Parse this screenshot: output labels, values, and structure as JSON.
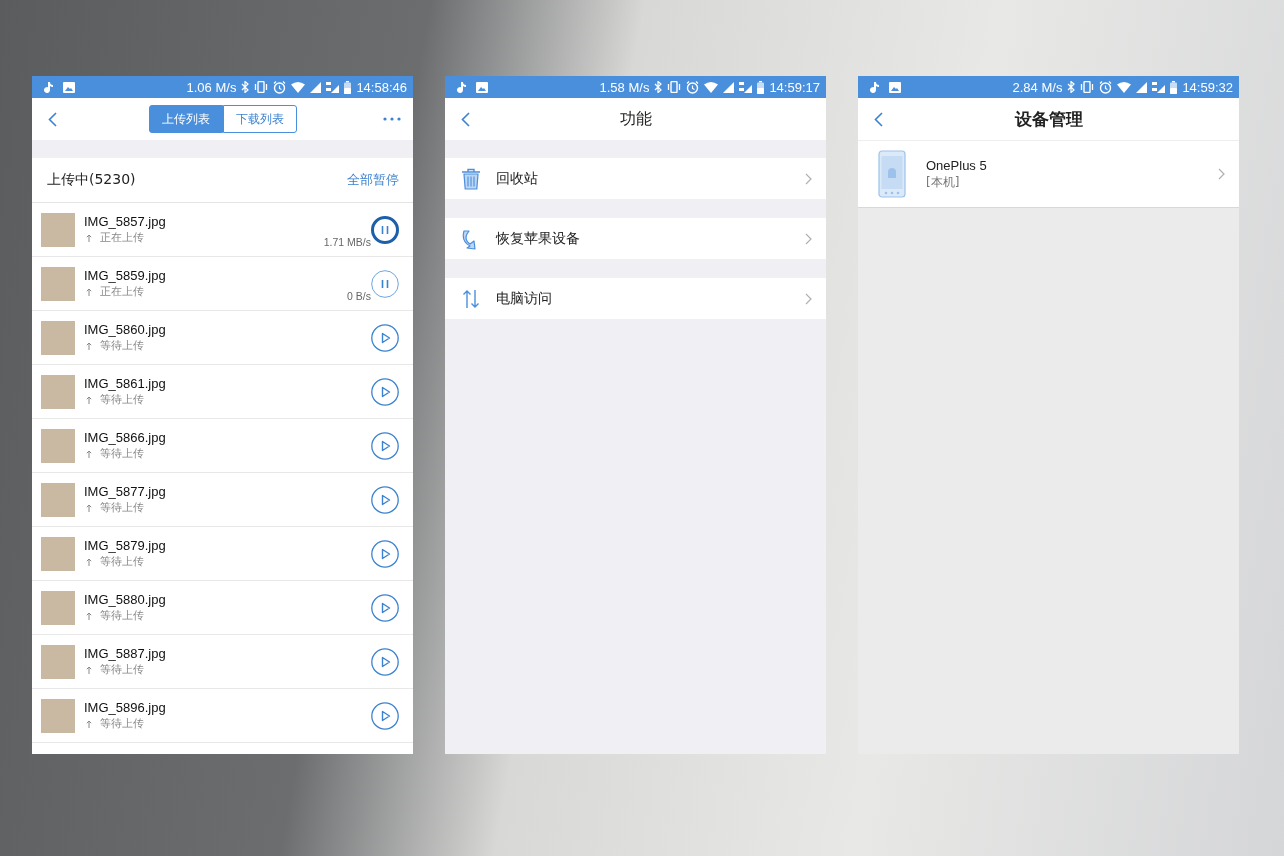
{
  "screens": [
    {
      "kind": "upload",
      "status_bar": {
        "speed": "1.06 M/s",
        "time": "14:58:46"
      },
      "tabs": [
        {
          "label": "上传列表",
          "selected": true
        },
        {
          "label": "下载列表",
          "selected": false
        }
      ],
      "section": {
        "title": "上传中(5230)",
        "action": "全部暂停"
      },
      "files": [
        {
          "name": "IMG_5857.jpg",
          "status": "正在上传",
          "speed": "1.71 MB/s",
          "kind": "uploading",
          "selected": true
        },
        {
          "name": "IMG_5859.jpg",
          "status": "正在上传",
          "speed": "0 B/s",
          "kind": "uploading",
          "selected": false
        },
        {
          "name": "IMG_5860.jpg",
          "status": "等待上传",
          "kind": "waiting",
          "selected": false
        },
        {
          "name": "IMG_5861.jpg",
          "status": "等待上传",
          "kind": "waiting",
          "selected": false
        },
        {
          "name": "IMG_5866.jpg",
          "status": "等待上传",
          "kind": "waiting",
          "selected": false
        },
        {
          "name": "IMG_5877.jpg",
          "status": "等待上传",
          "kind": "waiting",
          "selected": false
        },
        {
          "name": "IMG_5879.jpg",
          "status": "等待上传",
          "kind": "waiting",
          "selected": false
        },
        {
          "name": "IMG_5880.jpg",
          "status": "等待上传",
          "kind": "waiting",
          "selected": false
        },
        {
          "name": "IMG_5887.jpg",
          "status": "等待上传",
          "kind": "waiting",
          "selected": false
        },
        {
          "name": "IMG_5896.jpg",
          "status": "等待上传",
          "kind": "waiting",
          "selected": false
        }
      ]
    },
    {
      "kind": "features",
      "status_bar": {
        "speed": "1.58 M/s",
        "time": "14:59:17"
      },
      "title": "功能",
      "items": [
        {
          "label": "回收站",
          "kind": "trash"
        },
        {
          "label": "恢复苹果设备",
          "kind": "restore"
        },
        {
          "label": "电脑访问",
          "kind": "computer"
        }
      ]
    },
    {
      "kind": "devices",
      "status_bar": {
        "speed": "2.84 M/s",
        "time": "14:59:32"
      },
      "title": "设备管理",
      "devices": [
        {
          "name": "OnePlus 5",
          "note": "[本机]"
        }
      ]
    }
  ]
}
